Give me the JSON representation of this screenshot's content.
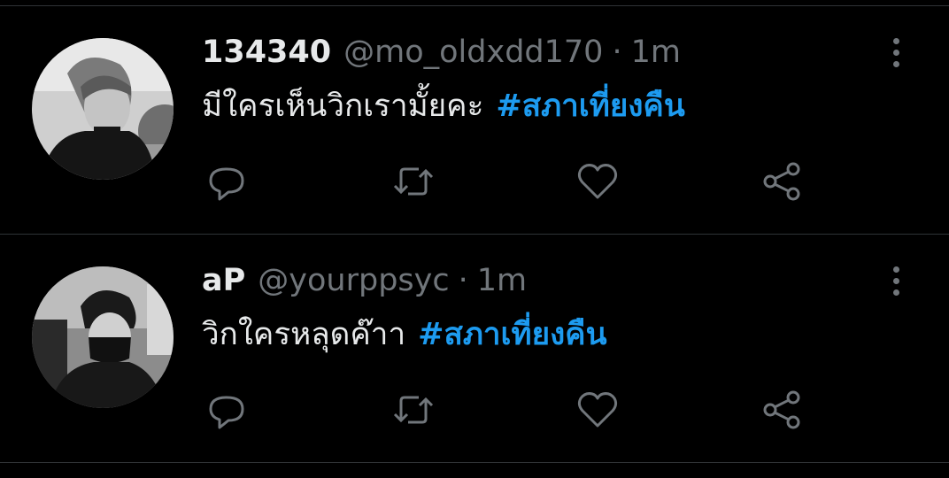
{
  "tweets": [
    {
      "display_name": "134340",
      "handle": "@mo_oldxdd170",
      "separator": "·",
      "time": "1m",
      "text": "มีใครเห็นวิกเรามั้ยคะ",
      "hashtag": "#สภาเที่ยงคืน"
    },
    {
      "display_name": "aP",
      "handle": "@yourppsyc",
      "separator": "·",
      "time": "1m",
      "text": "วิกใครหลุดค๊าา",
      "hashtag": "#สภาเที่ยงคืน"
    }
  ],
  "icons": {
    "reply": "reply-icon",
    "retweet": "retweet-icon",
    "like": "heart-icon",
    "share": "share-icon",
    "more": "more-vertical-icon"
  },
  "colors": {
    "background": "#000000",
    "text": "#e7e9ea",
    "secondary": "#71767b",
    "accent": "#1d9bf0",
    "divider": "#2f3336"
  }
}
